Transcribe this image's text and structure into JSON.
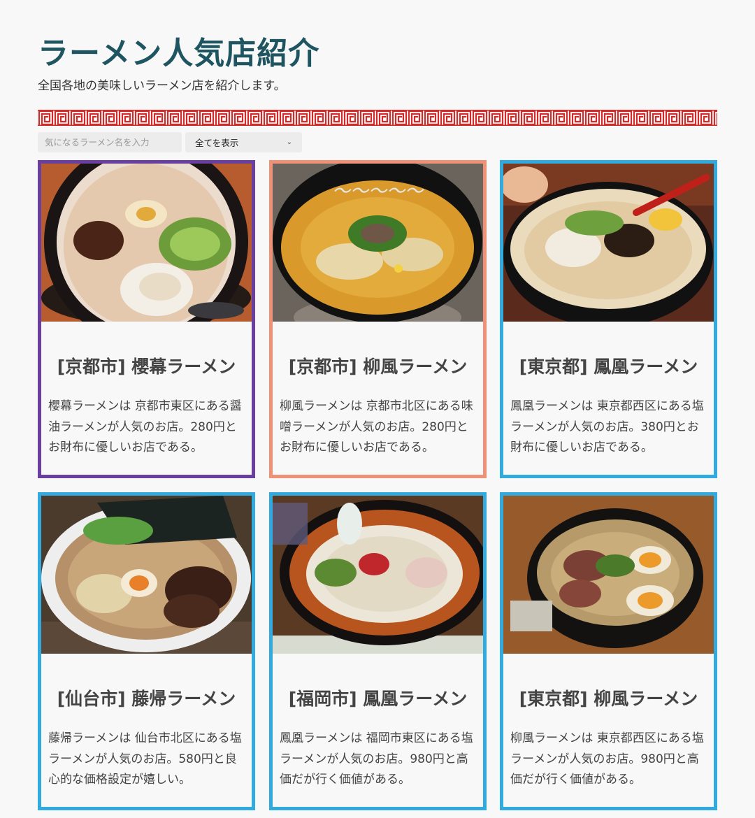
{
  "header": {
    "title": "ラーメン人気店紹介",
    "subtitle": "全国各地の美味しいラーメン店を紹介します。"
  },
  "controls": {
    "search_placeholder": "気になるラーメン名を入力",
    "filter_selected": "全てを表示"
  },
  "cards": [
    {
      "title": "[京都市] 櫻幕ラーメン",
      "description": "櫻幕ラーメンは 京都市東区にある醤油ラーメンが人気のお店。280円とお財布に優しいお店である。",
      "border_color": "#6b3fa0"
    },
    {
      "title": "[京都市] 柳風ラーメン",
      "description": "柳風ラーメンは 京都市北区にある味噌ラーメンが人気のお店。280円とお財布に優しいお店である。",
      "border_color": "#ee9176"
    },
    {
      "title": "[東京都] 鳳凰ラーメン",
      "description": "鳳凰ラーメンは 東京都西区にある塩ラーメンが人気のお店。380円とお財布に優しいお店である。",
      "border_color": "#33aadd"
    },
    {
      "title": "[仙台市] 藤帰ラーメン",
      "description": "藤帰ラーメンは 仙台市北区にある塩ラーメンが人気のお店。580円と良心的な価格設定が嬉しい。",
      "border_color": "#33aadd"
    },
    {
      "title": "[福岡市] 鳳凰ラーメン",
      "description": "鳳凰ラーメンは 福岡市東区にある塩ラーメンが人気のお店。980円と高価だが行く価値がある。",
      "border_color": "#33aadd"
    },
    {
      "title": "[東京都] 柳風ラーメン",
      "description": "柳風ラーメンは 東京都西区にある塩ラーメンが人気のお店。980円と高価だが行く価値がある。",
      "border_color": "#33aadd"
    }
  ],
  "colors": {
    "title": "#1e5561",
    "pattern_red": "#d42a2a",
    "purple": "#6b3fa0",
    "salmon": "#ee9176",
    "blue": "#33aadd"
  }
}
